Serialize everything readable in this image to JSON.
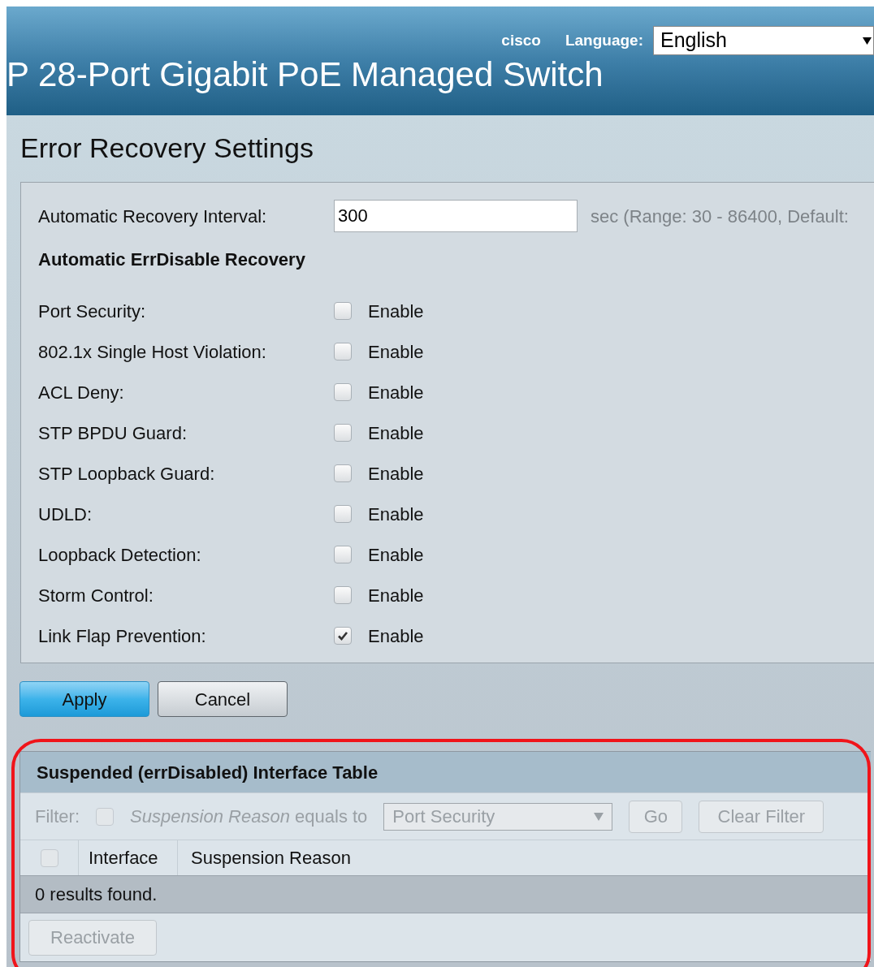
{
  "header": {
    "brand": "cisco",
    "language_label": "Language:",
    "language": "English",
    "title": "P 28-Port Gigabit PoE Managed Switch"
  },
  "page_title": "Error Recovery Settings",
  "interval": {
    "label": "Automatic Recovery Interval:",
    "value": "300",
    "hint": "sec (Range: 30 - 86400, Default:"
  },
  "section_title": "Automatic ErrDisable Recovery",
  "settings": [
    {
      "label": "Port Security:",
      "option": "Enable",
      "checked": false
    },
    {
      "label": "802.1x Single Host Violation:",
      "option": "Enable",
      "checked": false
    },
    {
      "label": "ACL Deny:",
      "option": "Enable",
      "checked": false
    },
    {
      "label": "STP BPDU Guard:",
      "option": "Enable",
      "checked": false
    },
    {
      "label": "STP Loopback Guard:",
      "option": "Enable",
      "checked": false
    },
    {
      "label": "UDLD:",
      "option": "Enable",
      "checked": false
    },
    {
      "label": "Loopback Detection:",
      "option": "Enable",
      "checked": false
    },
    {
      "label": "Storm Control:",
      "option": "Enable",
      "checked": false
    },
    {
      "label": "Link Flap Prevention:",
      "option": "Enable",
      "checked": true
    }
  ],
  "buttons": [
    "Apply",
    "Cancel"
  ],
  "table": {
    "title": "Suspended (errDisabled) Interface Table",
    "filter": {
      "label": "Filter:",
      "checked": false,
      "field": "Suspension Reason",
      "condition": "equals to",
      "value": "Port Security",
      "go": "Go",
      "clear": "Clear Filter"
    },
    "columns": [
      "Interface",
      "Suspension Reason"
    ],
    "select_all_checked": false,
    "status": "0 results found.",
    "action": "Reactivate"
  },
  "highlight": true
}
